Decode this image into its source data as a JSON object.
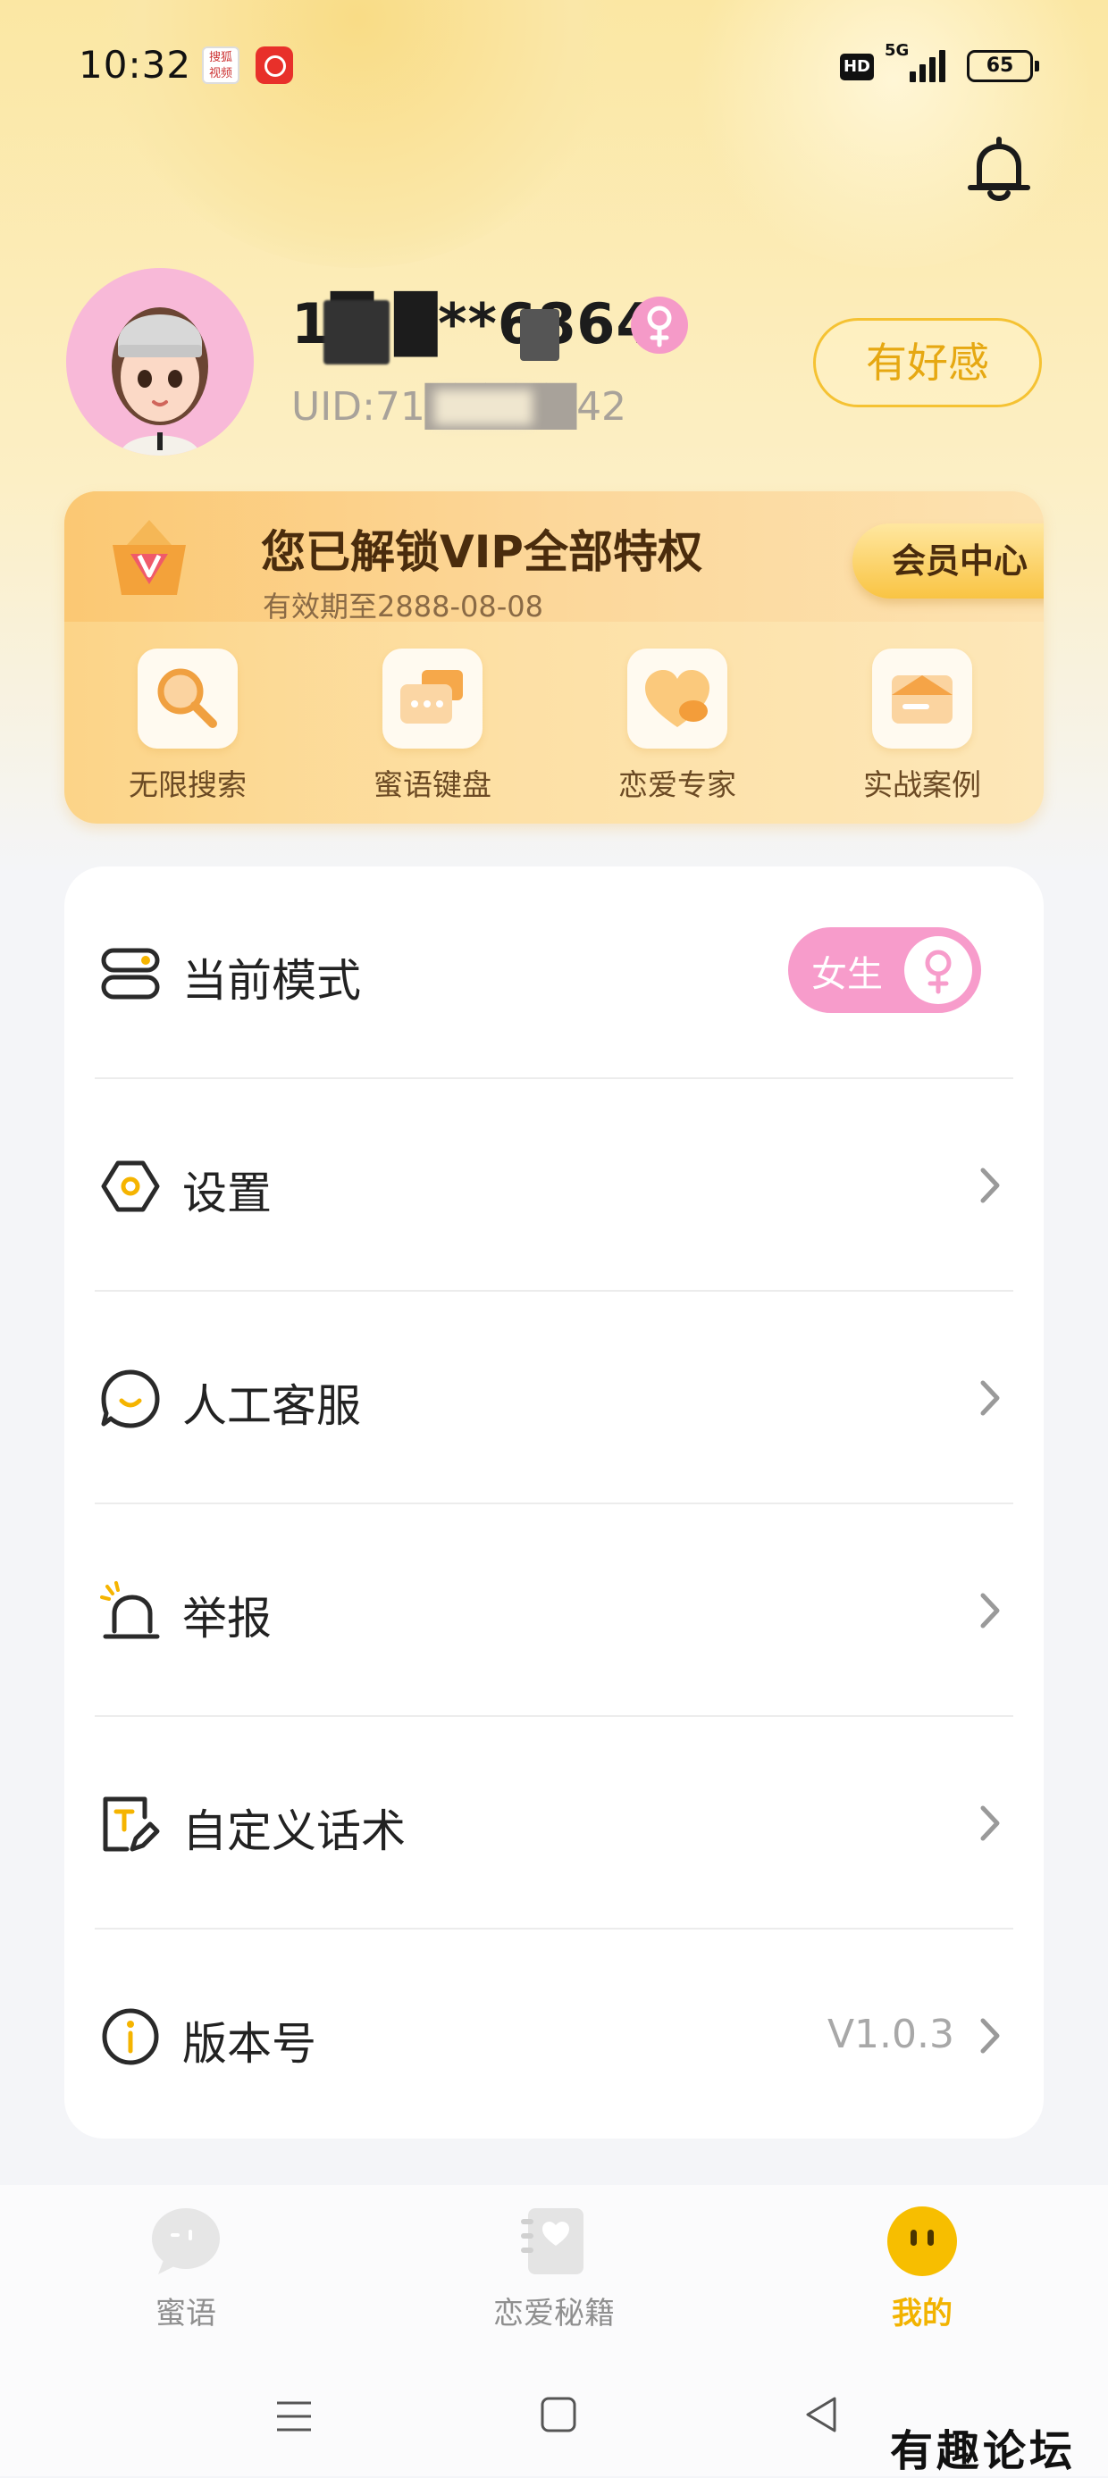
{
  "status_bar": {
    "time": "10:32",
    "app_icon_1_text": "搜狐\n视频",
    "hd": "HD",
    "network": "5G",
    "battery": "65"
  },
  "profile": {
    "username": "1█ █**6864",
    "uid": "UID:71█████42",
    "gender_icon": "female-icon",
    "favor_button": "有好感"
  },
  "vip": {
    "title": "您已解锁VIP全部特权",
    "subtitle": "有效期至2888-08-08",
    "center_button": "会员中心",
    "features": [
      {
        "label": "无限搜索",
        "icon": "search-icon"
      },
      {
        "label": "蜜语键盘",
        "icon": "keyboard-chat-icon"
      },
      {
        "label": "恋爱专家",
        "icon": "heart-icon"
      },
      {
        "label": "实战案例",
        "icon": "case-card-icon"
      }
    ]
  },
  "menu": {
    "items": [
      {
        "label": "当前模式",
        "icon": "mode-switch-icon",
        "mode_value": "女生"
      },
      {
        "label": "设置",
        "icon": "settings-icon"
      },
      {
        "label": "人工客服",
        "icon": "chat-service-icon"
      },
      {
        "label": "举报",
        "icon": "report-alarm-icon"
      },
      {
        "label": "自定义话术",
        "icon": "custom-text-icon"
      },
      {
        "label": "版本号",
        "icon": "info-icon",
        "value": "V1.0.3"
      }
    ]
  },
  "bottom_nav": {
    "tabs": [
      {
        "label": "蜜语",
        "icon": "chat-bubble-icon",
        "active": false
      },
      {
        "label": "恋爱秘籍",
        "icon": "love-book-icon",
        "active": false
      },
      {
        "label": "我的",
        "icon": "face-icon",
        "active": true
      }
    ]
  },
  "watermark": "有趣论坛",
  "colors": {
    "accent": "#f2b300",
    "pink": "#f79ccb",
    "vip_text": "#4a2c0d"
  }
}
